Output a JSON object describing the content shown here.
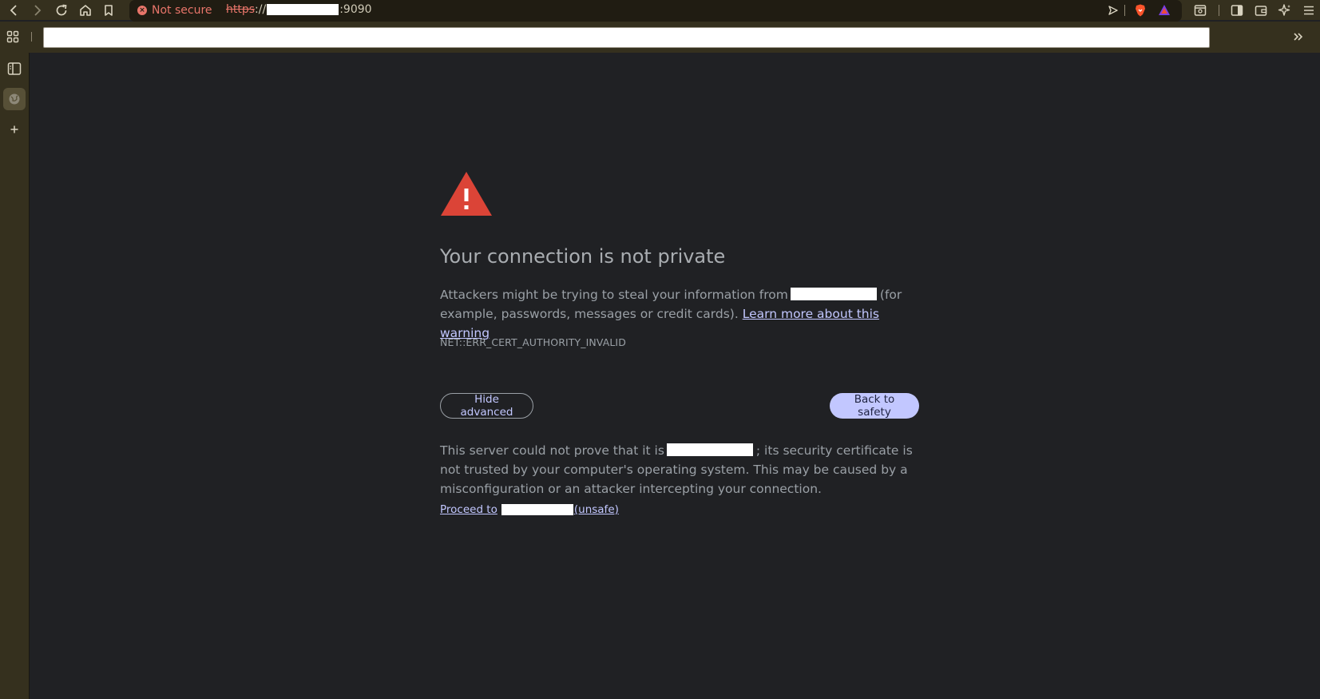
{
  "browser": {
    "toolbar": {
      "back_icon": "chevron-left-icon",
      "forward_icon": "chevron-right-icon",
      "reload_icon": "reload-icon",
      "home_icon": "home-icon",
      "bookmark_icon": "bookmark-icon",
      "security_label": "Not secure",
      "url_scheme": "https",
      "url_separator": "://",
      "url_port": ":9090",
      "right_icons": [
        "share-icon",
        "brave-shields-icon",
        "brave-rewards-icon",
        "tab-search-icon",
        "sidebar-toggle-icon",
        "wallet-icon",
        "leo-ai-icon",
        "menu-icon"
      ]
    },
    "bookmarks_bar": {
      "apps_icon": "apps-grid-icon",
      "input_value": "",
      "overflow_icon": "chevrons-right-icon"
    },
    "sidebar": {
      "items": [
        "sidebar-panel-icon",
        "globe-icon",
        "plus-icon"
      ]
    }
  },
  "page": {
    "heading": "Your connection is not private",
    "explanation_pre": "Attackers might be trying to steal your information from",
    "explanation_post": "(for example, passwords, messages or credit cards).",
    "learn_more": "Learn more about this warning",
    "error_code": "NET::ERR_CERT_AUTHORITY_INVALID",
    "hide_advanced": "Hide advanced",
    "back_to_safety": "Back to safety",
    "details_pre": "This server could not prove that it is",
    "details_post": "; its security certificate is not trusted by your computer's operating system. This may be caused by a misconfiguration or an attacker intercepting your connection.",
    "proceed_pre": "Proceed to",
    "proceed_post": "(unsafe)"
  },
  "colors": {
    "chrome": "#35301e",
    "background": "#202124",
    "warning_red": "#db4437",
    "link": "#c2c7ff",
    "not_secure": "#e8756a"
  }
}
